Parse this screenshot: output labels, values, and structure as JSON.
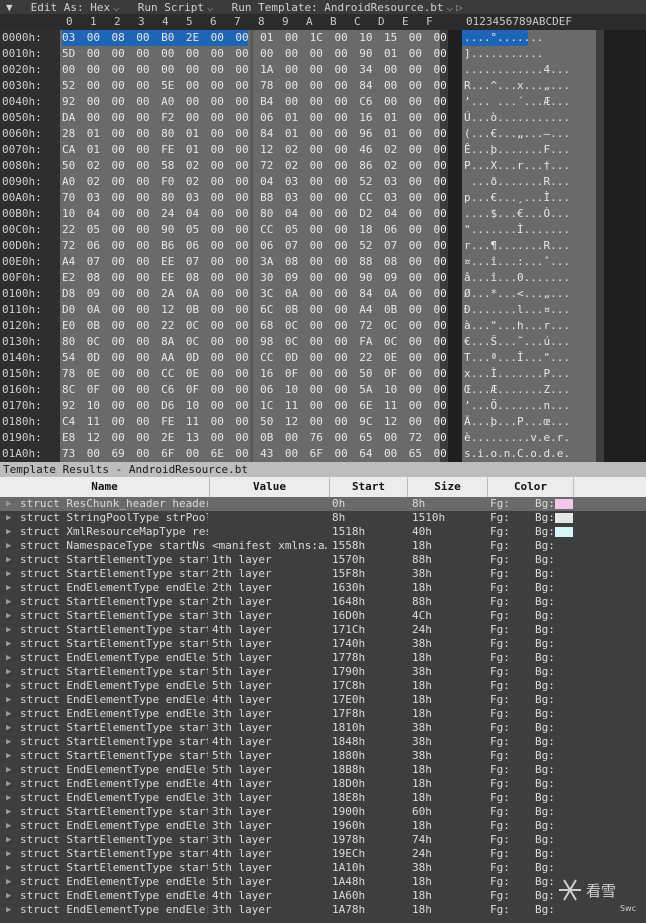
{
  "toolbar": {
    "edit_as": "Edit As: Hex",
    "run_script": "Run Script",
    "run_template": "Run Template: AndroidResource.bt"
  },
  "hex": {
    "col_digits": [
      "0",
      "1",
      "2",
      "3",
      "4",
      "5",
      "6",
      "7",
      "8",
      "9",
      "A",
      "B",
      "C",
      "D",
      "E",
      "F"
    ],
    "ascii_header": "0123456789ABCDEF",
    "rows": [
      {
        "addr": "0000h:",
        "hex": "03 00 08 00 B0 2E 00 00 01 00 1C 00 10 15 00 00",
        "asc": "....°......."
      },
      {
        "addr": "0010h:",
        "hex": "5D 00 00 00 00 00 00 00 00 00 00 00 90 01 00 00",
        "asc": "]..........."
      },
      {
        "addr": "0020h:",
        "hex": "00 00 00 00 00 00 00 00 1A 00 00 00 34 00 00 00",
        "asc": "............4..."
      },
      {
        "addr": "0030h:",
        "hex": "52 00 00 00 5E 00 00 00 78 00 00 00 84 00 00 00",
        "asc": "R...^...x...„..."
      },
      {
        "addr": "0040h:",
        "hex": "92 00 00 00 A0 00 00 00 B4 00 00 00 C6 00 00 00",
        "asc": "’... ...´...Æ..."
      },
      {
        "addr": "0050h:",
        "hex": "DA 00 00 00 F2 00 00 00 06 01 00 00 16 01 00 00",
        "asc": "Ú...ò..........."
      },
      {
        "addr": "0060h:",
        "hex": "28 01 00 00 80 01 00 00 84 01 00 00 96 01 00 00",
        "asc": "(...€...„...–..."
      },
      {
        "addr": "0070h:",
        "hex": "CA 01 00 00 FE 01 00 00 12 02 00 00 46 02 00 00",
        "asc": "Ê...þ.......F..."
      },
      {
        "addr": "0080h:",
        "hex": "50 02 00 00 58 02 00 00 72 02 00 00 86 02 00 00",
        "asc": "P...X...r...†..."
      },
      {
        "addr": "0090h:",
        "hex": "A0 02 00 00 F0 02 00 00 04 03 00 00 52 03 00 00",
        "asc": " ...ð.......R..."
      },
      {
        "addr": "00A0h:",
        "hex": "70 03 00 00 80 03 00 00 B8 03 00 00 CC 03 00 00",
        "asc": "p...€...¸...Ì..."
      },
      {
        "addr": "00B0h:",
        "hex": "10 04 00 00 24 04 00 00 80 04 00 00 D2 04 00 00",
        "asc": "....$...€...Ò..."
      },
      {
        "addr": "00C0h:",
        "hex": "22 05 00 00 90 05 00 00 CC 05 00 00 18 06 00 00",
        "asc": "\".......Ì......."
      },
      {
        "addr": "00D0h:",
        "hex": "72 06 00 00 B6 06 00 00 06 07 00 00 52 07 00 00",
        "asc": "r...¶.......R..."
      },
      {
        "addr": "00E0h:",
        "hex": "A4 07 00 00 EE 07 00 00 3A 08 00 00 88 08 00 00",
        "asc": "¤...î...:...ˆ..."
      },
      {
        "addr": "00F0h:",
        "hex": "E2 08 00 00 EE 08 00 00 30 09 00 00 90 09 00 00",
        "asc": "â...î...0......."
      },
      {
        "addr": "0100h:",
        "hex": "D8 09 00 00 2A 0A 00 00 3C 0A 00 00 84 0A 00 00",
        "asc": "Ø...*...<...„..."
      },
      {
        "addr": "0110h:",
        "hex": "D0 0A 00 00 12 0B 00 00 6C 0B 00 00 A4 0B 00 00",
        "asc": "Ð.......l...¤..."
      },
      {
        "addr": "0120h:",
        "hex": "E0 0B 00 00 22 0C 00 00 68 0C 00 00 72 0C 00 00",
        "asc": "à...\"...h...r..."
      },
      {
        "addr": "0130h:",
        "hex": "80 0C 00 00 8A 0C 00 00 98 0C 00 00 FA 0C 00 00",
        "asc": "€...Š...˜...ú..."
      },
      {
        "addr": "0140h:",
        "hex": "54 0D 00 00 AA 0D 00 00 CC 0D 00 00 22 0E 00 00",
        "asc": "T...ª...Ì...\"..."
      },
      {
        "addr": "0150h:",
        "hex": "78 0E 00 00 CC 0E 00 00 16 0F 00 00 50 0F 00 00",
        "asc": "x...Ì.......P..."
      },
      {
        "addr": "0160h:",
        "hex": "8C 0F 00 00 C6 0F 00 00 06 10 00 00 5A 10 00 00",
        "asc": "Œ...Æ.......Z..."
      },
      {
        "addr": "0170h:",
        "hex": "92 10 00 00 D6 10 00 00 1C 11 00 00 6E 11 00 00",
        "asc": "’...Ö.......n..."
      },
      {
        "addr": "0180h:",
        "hex": "C4 11 00 00 FE 11 00 00 50 12 00 00 9C 12 00 00",
        "asc": "Ä...þ...P...œ..."
      },
      {
        "addr": "0190h:",
        "hex": "E8 12 00 00 2E 13 00 00 0B 00 76 00 65 00 72 00",
        "asc": "è.........v.e.r."
      },
      {
        "addr": "01A0h:",
        "hex": "73 00 69 00 6F 00 6E 00 43 00 6F 00 64 00 65 00",
        "asc": "s.i.o.n.C.o.d.e."
      }
    ]
  },
  "template": {
    "title": "Template Results - AndroidResource.bt",
    "headers": {
      "name": "Name",
      "value": "Value",
      "start": "Start",
      "size": "Size",
      "color": "Color"
    },
    "rows": [
      {
        "name": "struct ResChunk_header header",
        "value": "",
        "start": "0h",
        "size": "8h",
        "fg": "Fg:",
        "bg": "Bg:",
        "swatch": "#f3c8ee"
      },
      {
        "name": "struct StringPoolType strPool",
        "value": "",
        "start": "8h",
        "size": "1510h",
        "fg": "Fg:",
        "bg": "Bg:",
        "swatch": "#e6e6e6"
      },
      {
        "name": "struct XmlResourceMapType res…",
        "value": "",
        "start": "1518h",
        "size": "40h",
        "fg": "Fg:",
        "bg": "Bg:",
        "swatch": "#d6f6f6"
      },
      {
        "name": "struct NamespaceType startNs",
        "value": "<manifest xmlns:a…",
        "start": "1558h",
        "size": "18h",
        "fg": "Fg:",
        "bg": "Bg:",
        "swatch": ""
      },
      {
        "name": "struct StartElementType start…",
        "value": "1th layer",
        "start": "1570h",
        "size": "88h",
        "fg": "Fg:",
        "bg": "Bg:",
        "swatch": ""
      },
      {
        "name": "struct StartElementType start…",
        "value": "2th layer",
        "start": "15F8h",
        "size": "38h",
        "fg": "Fg:",
        "bg": "Bg:",
        "swatch": ""
      },
      {
        "name": "struct EndElementType endEle[0]",
        "value": "2th layer",
        "start": "1630h",
        "size": "18h",
        "fg": "Fg:",
        "bg": "Bg:",
        "swatch": ""
      },
      {
        "name": "struct StartElementType start…",
        "value": "2th layer",
        "start": "1648h",
        "size": "88h",
        "fg": "Fg:",
        "bg": "Bg:",
        "swatch": ""
      },
      {
        "name": "struct StartElementType start…",
        "value": "3th layer",
        "start": "16D0h",
        "size": "4Ch",
        "fg": "Fg:",
        "bg": "Bg:",
        "swatch": ""
      },
      {
        "name": "struct StartElementType start…",
        "value": "4th layer",
        "start": "171Ch",
        "size": "24h",
        "fg": "Fg:",
        "bg": "Bg:",
        "swatch": ""
      },
      {
        "name": "struct StartElementType start…",
        "value": "5th layer",
        "start": "1740h",
        "size": "38h",
        "fg": "Fg:",
        "bg": "Bg:",
        "swatch": ""
      },
      {
        "name": "struct EndElementType endEle[1]",
        "value": "5th layer",
        "start": "1778h",
        "size": "18h",
        "fg": "Fg:",
        "bg": "Bg:",
        "swatch": ""
      },
      {
        "name": "struct StartElementType start…",
        "value": "5th layer",
        "start": "1790h",
        "size": "38h",
        "fg": "Fg:",
        "bg": "Bg:",
        "swatch": ""
      },
      {
        "name": "struct EndElementType endEle[2]",
        "value": "5th layer",
        "start": "17C8h",
        "size": "18h",
        "fg": "Fg:",
        "bg": "Bg:",
        "swatch": ""
      },
      {
        "name": "struct EndElementType endEle[3]",
        "value": "4th layer",
        "start": "17E0h",
        "size": "18h",
        "fg": "Fg:",
        "bg": "Bg:",
        "swatch": ""
      },
      {
        "name": "struct EndElementType endEle[4]",
        "value": "3th layer",
        "start": "17F8h",
        "size": "18h",
        "fg": "Fg:",
        "bg": "Bg:",
        "swatch": ""
      },
      {
        "name": "struct StartElementType start…",
        "value": "3th layer",
        "start": "1810h",
        "size": "38h",
        "fg": "Fg:",
        "bg": "Bg:",
        "swatch": ""
      },
      {
        "name": "struct StartElementType start…",
        "value": "4th layer",
        "start": "1848h",
        "size": "38h",
        "fg": "Fg:",
        "bg": "Bg:",
        "swatch": ""
      },
      {
        "name": "struct StartElementType start…",
        "value": "5th layer",
        "start": "1880h",
        "size": "38h",
        "fg": "Fg:",
        "bg": "Bg:",
        "swatch": ""
      },
      {
        "name": "struct EndElementType endEle[5]",
        "value": "5th layer",
        "start": "18B8h",
        "size": "18h",
        "fg": "Fg:",
        "bg": "Bg:",
        "swatch": ""
      },
      {
        "name": "struct EndElementType endEle[6]",
        "value": "4th layer",
        "start": "18D0h",
        "size": "18h",
        "fg": "Fg:",
        "bg": "Bg:",
        "swatch": ""
      },
      {
        "name": "struct EndElementType endEle[7]",
        "value": "3th layer",
        "start": "18E8h",
        "size": "18h",
        "fg": "Fg:",
        "bg": "Bg:",
        "swatch": ""
      },
      {
        "name": "struct StartElementType start…",
        "value": "3th layer",
        "start": "1900h",
        "size": "60h",
        "fg": "Fg:",
        "bg": "Bg:",
        "swatch": ""
      },
      {
        "name": "struct EndElementType endEle[8]",
        "value": "3th layer",
        "start": "1960h",
        "size": "18h",
        "fg": "Fg:",
        "bg": "Bg:",
        "swatch": ""
      },
      {
        "name": "struct StartElementType start…",
        "value": "3th layer",
        "start": "1978h",
        "size": "74h",
        "fg": "Fg:",
        "bg": "Bg:",
        "swatch": ""
      },
      {
        "name": "struct StartElementType start…",
        "value": "4th layer",
        "start": "19ECh",
        "size": "24h",
        "fg": "Fg:",
        "bg": "Bg:",
        "swatch": ""
      },
      {
        "name": "struct StartElementType start…",
        "value": "5th layer",
        "start": "1A10h",
        "size": "38h",
        "fg": "Fg:",
        "bg": "Bg:",
        "swatch": ""
      },
      {
        "name": "struct EndElementType endEle[9]",
        "value": "5th layer",
        "start": "1A48h",
        "size": "18h",
        "fg": "Fg:",
        "bg": "Bg:",
        "swatch": ""
      },
      {
        "name": "struct EndElementType endEle[…",
        "value": "4th layer",
        "start": "1A60h",
        "size": "18h",
        "fg": "Fg:",
        "bg": "Bg:",
        "swatch": ""
      },
      {
        "name": "struct EndElementType endEle[…",
        "value": "3th layer",
        "start": "1A78h",
        "size": "18h",
        "fg": "Fg:",
        "bg": "Bg:",
        "swatch": ""
      }
    ]
  },
  "watermark": {
    "text": "看雪",
    "small": "Swc"
  }
}
